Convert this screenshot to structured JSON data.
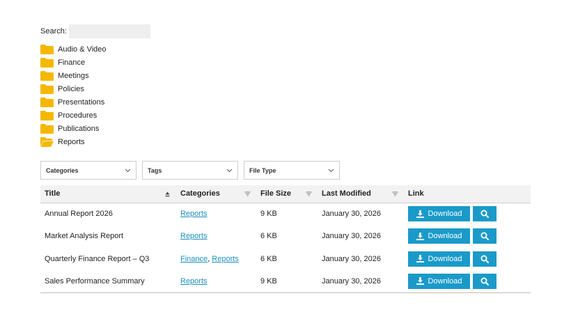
{
  "search": {
    "label": "Search:",
    "value": "",
    "placeholder": ""
  },
  "folders": [
    {
      "label": "Audio & Video",
      "icon": "folder-icon",
      "open": false
    },
    {
      "label": "Finance",
      "icon": "folder-icon",
      "open": false
    },
    {
      "label": "Meetings",
      "icon": "folder-icon",
      "open": false
    },
    {
      "label": "Policies",
      "icon": "folder-icon",
      "open": false
    },
    {
      "label": "Presentations",
      "icon": "folder-icon",
      "open": false
    },
    {
      "label": "Procedures",
      "icon": "folder-icon",
      "open": false
    },
    {
      "label": "Publications",
      "icon": "folder-icon",
      "open": false
    },
    {
      "label": "Reports",
      "icon": "folder-open-icon",
      "open": true
    }
  ],
  "filters": {
    "categories": "Categories",
    "tags": "Tags",
    "file_type": "File Type"
  },
  "table": {
    "headers": {
      "title": "Title",
      "categories": "Categories",
      "file_size": "File Size",
      "last_modified": "Last Modified",
      "link": "Link"
    },
    "rows": [
      {
        "title": "Annual Report 2026",
        "categories": [
          "Reports"
        ],
        "file_size": "9 KB",
        "last_modified": "January 30, 2026"
      },
      {
        "title": "Market Analysis Report",
        "categories": [
          "Reports"
        ],
        "file_size": "6 KB",
        "last_modified": "January 30, 2026"
      },
      {
        "title": "Quarterly Finance Report – Q3",
        "categories": [
          "Finance",
          "Reports"
        ],
        "file_size": "6 KB",
        "last_modified": "January 30, 2026"
      },
      {
        "title": "Sales Performance Summary",
        "categories": [
          "Reports"
        ],
        "file_size": "9 KB",
        "last_modified": "January 30, 2026"
      }
    ],
    "download_label": "Download",
    "category_separator": ", "
  },
  "colors": {
    "folder": "#f5b800",
    "accent": "#1a9ac9",
    "link": "#1a8fc0",
    "header_bg": "#f2f2f2"
  }
}
